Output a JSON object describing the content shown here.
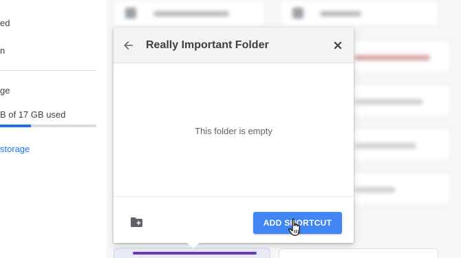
{
  "sidebar": {
    "item_1": "ed",
    "item_2": "n",
    "storage_heading": "ge",
    "storage_usage": "B of 17 GB used",
    "storage_percent": 0.32,
    "buy_storage_link": "storage"
  },
  "dialog": {
    "title": "Really Important Folder",
    "back_icon": "arrow-back-icon",
    "close_icon": "close-icon",
    "empty_message": "This folder is empty",
    "new_folder_icon": "create-new-folder-icon",
    "primary_button": "ADD SHORTCUT"
  },
  "colors": {
    "accent": "#4285f4",
    "link": "#1a73e8",
    "dialog_header": "#f1f3f4",
    "selected_folder": "#6a3ab2"
  }
}
